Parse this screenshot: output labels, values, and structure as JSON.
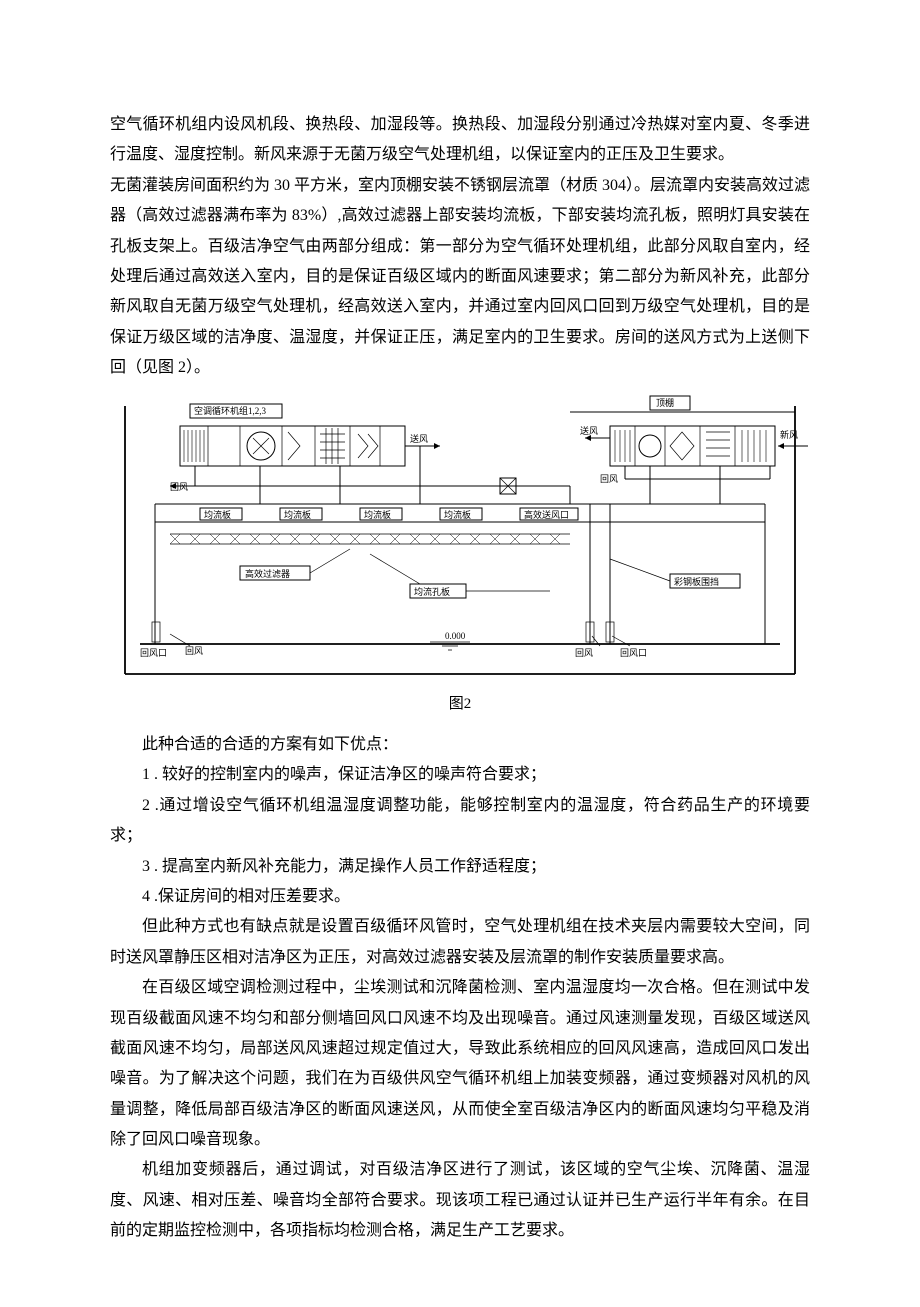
{
  "p1": "空气循环机组内设风机段、换热段、加湿段等。换热段、加湿段分别通过冷热媒对室内夏、冬季进行温度、湿度控制。新风来源于无菌万级空气处理机组，以保证室内的正压及卫生要求。",
  "p2": "无菌灌装房间面积约为 30 平方米，室内顶棚安装不锈钢层流罩（材质 304）。层流罩内安装高效过滤器（高效过滤器满布率为 83%）,高效过滤器上部安装均流板，下部安装均流孔板，照明灯具安装在孔板支架上。百级洁净空气由两部分组成：第一部分为空气循环处理机组，此部分风取自室内，经处理后通过高效送入室内，目的是保证百级区域内的断面风速要求；第二部分为新风补充，此部分新风取自无菌万级空气处理机，经高效送入室内，并通过室内回风口回到万级空气处理机，目的是保证万级区域的洁净度、温湿度，并保证正压，满足室内的卫生要求。房间的送风方式为上送侧下回（见图 2）。",
  "caption": "图2",
  "advIntro": "此种合适的合适的方案有如下优点：",
  "adv1": "1 . 较好的控制室内的噪声，保证洁净区的噪声符合要求；",
  "adv2": "2  .通过增设空气循环机组温湿度调整功能，能够控制室内的温湿度，符合药品生产的环境要求；",
  "adv2tail": "",
  "adv3": "3 . 提高室内新风补充能力，满足操作人员工作舒适程度；",
  "adv4": "4  .保证房间的相对压差要求。",
  "p3": "但此种方式也有缺点就是设置百级循环风管时，空气处理机组在技术夹层内需要较大空间，同时送风罩静压区相对洁净区为正压，对高效过滤器安装及层流罩的制作安装质量要求高。",
  "p4": "在百级区域空调检测过程中，尘埃测试和沉降菌检测、室内温湿度均一次合格。但在测试中发现百级截面风速不均匀和部分侧墙回风口风速不均及出现噪音。通过风速测量发现，百级区域送风截面风速不均匀，局部送风风速超过规定值过大，导致此系统相应的回风风速高，造成回风口发出噪音。为了解决这个问题，我们在为百级供风空气循环机组上加装变频器，通过变频器对风机的风量调整，降低局部百级洁净区的断面风速送风，从而使全室百级洁净区内的断面风速均匀平稳及消除了回风口噪音现象。",
  "p5": "机组加变频器后，通过调试，对百级洁净区进行了测试，该区域的空气尘埃、沉降菌、温湿度、风速、相对压差、噪音均全部符合要求。现该项工程已通过认证并已生产运行半年有余。在目前的定期监控检测中，各项指标均检测合格，满足生产工艺要求。",
  "diagram": {
    "unitLabel": "空调循环机组1,2,3",
    "supply": "送风",
    "return": "回风",
    "returnOutlet": "回风口",
    "efficientOutlet": "高效送风口",
    "balanceBoard": "均流板",
    "hepa": "高效过滤器",
    "orificePlate": "均流孔板",
    "colorEnclosure": "彩钢板围挡",
    "newAir": "新风",
    "roof": "顶棚",
    "ground": "0.000"
  }
}
